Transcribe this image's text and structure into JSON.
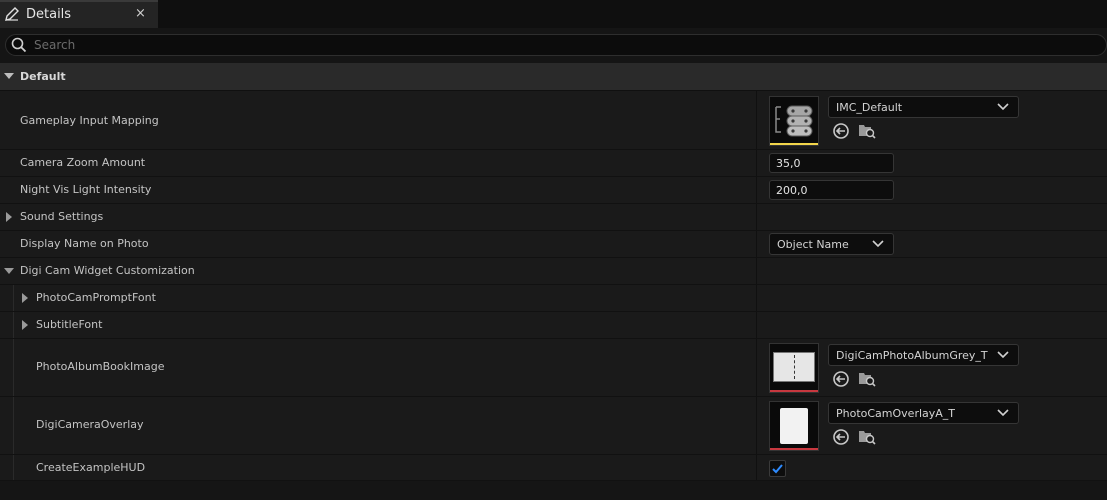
{
  "tab": {
    "title": "Details",
    "close": "×",
    "icon": "pencil-icon"
  },
  "search": {
    "placeholder": "Search",
    "icon": "search-icon"
  },
  "section": {
    "title": "Default"
  },
  "colors": {
    "asset_bar_yellow": "#f2d54b",
    "asset_bar_red": "#c8383f",
    "checkbox_blue": "#2e8bff"
  },
  "properties": {
    "gameplay_input_mapping": {
      "label": "Gameplay Input Mapping",
      "value": "IMC_Default",
      "thumbnail_icon": "gamepad-stack-icon"
    },
    "camera_zoom_amount": {
      "label": "Camera Zoom Amount",
      "value": "35,0"
    },
    "night_vis_light_intensity": {
      "label": "Night Vis Light Intensity",
      "value": "200,0"
    },
    "sound_settings": {
      "label": "Sound Settings"
    },
    "display_name_on_photo": {
      "label": "Display Name on Photo",
      "value": "Object Name"
    },
    "digi_cam_widget_customization": {
      "label": "Digi Cam Widget Customization"
    },
    "photo_cam_prompt_font": {
      "label": "PhotoCamPromptFont"
    },
    "subtitle_font": {
      "label": "SubtitleFont"
    },
    "photo_album_book_image": {
      "label": "PhotoAlbumBookImage",
      "value": "DigiCamPhotoAlbumGrey_T"
    },
    "digi_camera_overlay": {
      "label": "DigiCameraOverlay",
      "value": "PhotoCamOverlayA_T"
    },
    "create_example_hud": {
      "label": "CreateExampleHUD",
      "checked": true
    }
  }
}
